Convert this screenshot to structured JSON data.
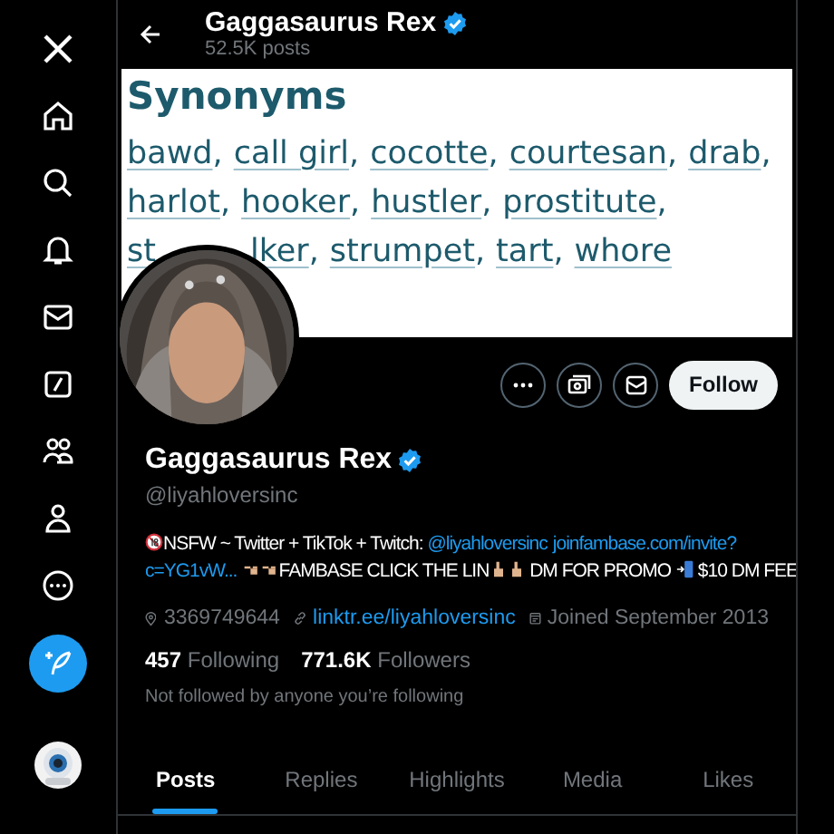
{
  "header": {
    "name": "Gaggasaurus Rex",
    "verified": true,
    "posts": "52.5K posts"
  },
  "banner": {
    "title": "Synonyms",
    "lines": [
      [
        {
          "word": "bawd",
          "punct": ","
        },
        {
          "word": "call girl",
          "punct": ","
        },
        {
          "word": "cocotte",
          "punct": ","
        },
        {
          "word": "courtesan",
          "punct": ","
        },
        {
          "word": "drab",
          "punct": ","
        }
      ],
      [
        {
          "word": "harlot",
          "punct": ","
        },
        {
          "word": "hooker",
          "punct": ","
        },
        {
          "word": "hustler",
          "punct": ","
        },
        {
          "word": "prostitute",
          "punct": ","
        }
      ],
      [
        {
          "word": "st",
          "kind": "covered"
        },
        {
          "word": "lker",
          "punct": ","
        },
        {
          "word": "strumpet",
          "punct": ","
        },
        {
          "word": "tart",
          "punct": ","
        },
        {
          "word": "whore"
        }
      ]
    ]
  },
  "profile": {
    "name": "Gaggasaurus Rex",
    "verified": true,
    "handle": "@liyahloversinc",
    "follow_button": "Follow",
    "bio": [
      {
        "kind": "adult"
      },
      {
        "kind": "text",
        "text": "NSFW ~ Twitter + TikTok + Twitch: "
      },
      {
        "kind": "link",
        "text": "@liyahloversinc"
      },
      {
        "kind": "link",
        "text": "joinfambase.com/invite?"
      },
      {
        "kind": "newline"
      },
      {
        "kind": "link",
        "text": "c=YG1vW..."
      },
      {
        "kind": "hand"
      },
      {
        "kind": "hand"
      },
      {
        "kind": "text",
        "text": "FAMBASE CLICK THE LIN"
      },
      {
        "kind": "finger"
      },
      {
        "kind": "finger"
      },
      {
        "kind": "text",
        "text": " DM FOR PROMO "
      },
      {
        "kind": "phone"
      },
      {
        "kind": "text",
        "text": " $10 DM FEE"
      }
    ],
    "location": "3369749644",
    "website": "linktr.ee/liyahloversinc",
    "joined": "Joined September 2013",
    "following_count": "457",
    "following_label": "Following",
    "followers_count": "771.6K",
    "followers_label": "Followers",
    "followed_by": "Not followed by anyone you’re following"
  },
  "tabs": [
    {
      "label": "Posts",
      "selected": true
    },
    {
      "label": "Replies",
      "selected": false
    },
    {
      "label": "Highlights",
      "selected": false
    },
    {
      "label": "Media",
      "selected": false
    },
    {
      "label": "Likes",
      "selected": false
    }
  ]
}
